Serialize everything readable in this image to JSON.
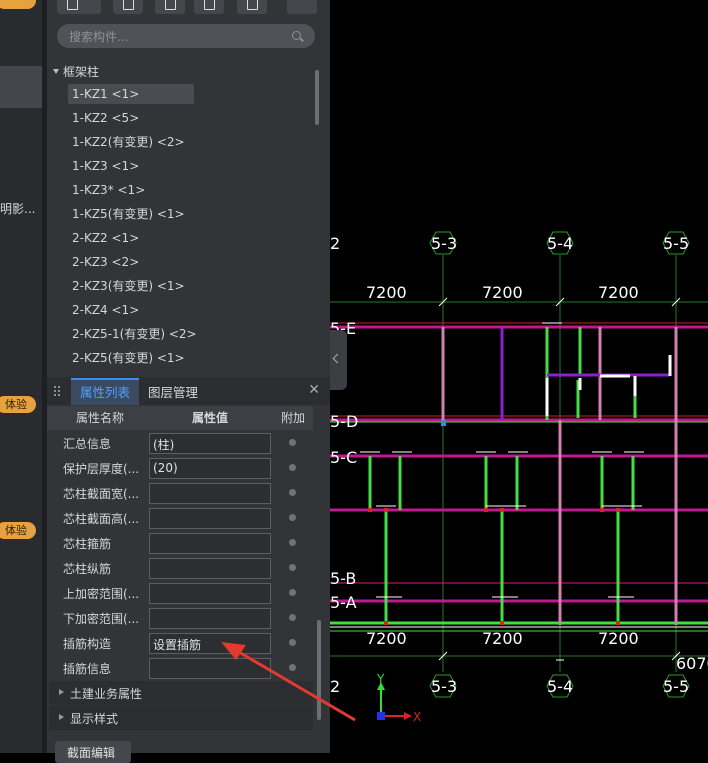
{
  "left_strip": {
    "item_text": "明影...",
    "badge_1": "体验",
    "badge_2": "体验"
  },
  "search": {
    "placeholder": "搜索构件..."
  },
  "tree": {
    "root": "框架柱",
    "items": [
      {
        "label": "1-KZ1  <1>",
        "selected": true
      },
      {
        "label": "1-KZ2  <5>"
      },
      {
        "label": "1-KZ2(有变更)  <2>"
      },
      {
        "label": "1-KZ3  <1>"
      },
      {
        "label": "1-KZ3*  <1>"
      },
      {
        "label": "1-KZ5(有变更)  <1>"
      },
      {
        "label": "2-KZ2  <1>"
      },
      {
        "label": "2-KZ3  <2>"
      },
      {
        "label": "2-KZ3(有变更)  <1>"
      },
      {
        "label": "2-KZ4  <1>"
      },
      {
        "label": "2-KZ5-1(有变更)  <2>"
      },
      {
        "label": "2-KZ5(有变更)  <1>"
      }
    ]
  },
  "property_panel": {
    "tabs": [
      "属性列表",
      "图层管理"
    ],
    "close": "✕",
    "columns": [
      "属性名称",
      "属性值",
      "附加"
    ],
    "rows": [
      {
        "name": "汇总信息",
        "value": "(柱)"
      },
      {
        "name": "保护层厚度(...",
        "value": "(20)"
      },
      {
        "name": "芯柱截面宽(...",
        "value": ""
      },
      {
        "name": "芯柱截面高(...",
        "value": ""
      },
      {
        "name": "芯柱箍筋",
        "value": ""
      },
      {
        "name": "芯柱纵筋",
        "value": ""
      },
      {
        "name": "上加密范围(...",
        "value": ""
      },
      {
        "name": "下加密范围(...",
        "value": ""
      },
      {
        "name": "插筋构造",
        "value": "设置插筋"
      },
      {
        "name": "插筋信息",
        "value": ""
      }
    ],
    "sections": [
      "土建业务属性",
      "显示样式"
    ],
    "bottom_button": "截面编辑"
  },
  "drawing": {
    "top_axis_labels": [
      "2",
      "5-3",
      "5-4",
      "5-5"
    ],
    "bottom_axis_labels": [
      "2",
      "5-3",
      "5-4",
      "5-5"
    ],
    "top_dimensions": [
      "7200",
      "7200",
      "7200"
    ],
    "bottom_dimensions": [
      "7200",
      "7200",
      "7200"
    ],
    "bottom_right_dimension": "6070",
    "row_labels": [
      "5-E",
      "5-D",
      "5-C",
      "5-B",
      "5-A"
    ],
    "ucs": {
      "x": "X",
      "y": "Y"
    },
    "colors": {
      "background": "#000000",
      "axis": "#2a7a2a",
      "column": "#44dd44",
      "beam": "#d0208a",
      "white": "#ffffff",
      "dimension": "#ffffff"
    }
  }
}
